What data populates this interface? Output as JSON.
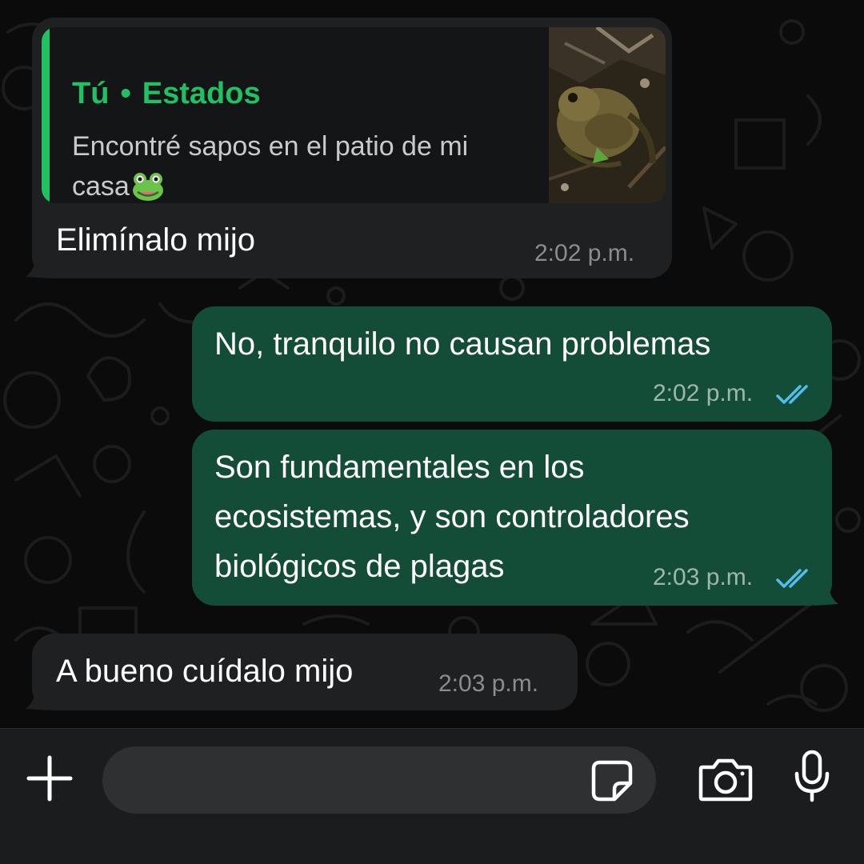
{
  "chat": {
    "messages": [
      {
        "direction": "incoming",
        "quoted_status": {
          "author": "Tú",
          "source": "Estados",
          "text": "Encontré sapos en el patio de mi casa",
          "emoji_icon": "frog-emoji-icon",
          "thumbnail": "toad-photo-thumbnail"
        },
        "text": "Elimínalo mijo",
        "time": "2:02 p.m."
      },
      {
        "direction": "outgoing",
        "text": "No, tranquilo no causan problemas",
        "time": "2:02 p.m.",
        "status_icon": "double-check-read-icon"
      },
      {
        "direction": "outgoing",
        "text": "Son fundamentales en los\necosistemas, y son controladores\nbiológicos de plagas",
        "time": "2:03 p.m.",
        "status_icon": "double-check-read-icon"
      },
      {
        "direction": "incoming",
        "text": "A bueno cuídalo mijo",
        "time": "2:03 p.m."
      }
    ]
  },
  "input_bar": {
    "placeholder": "",
    "icons": [
      "plus-icon",
      "sticker-icon",
      "camera-icon",
      "microphone-icon"
    ]
  },
  "colors": {
    "background": "#0b0b0b",
    "incoming_bubble": "#1f2021",
    "outgoing_bubble": "#144d37",
    "accent": "#21c063",
    "read_ticks": "#53bdeb",
    "timestamp": "#8a8d90"
  }
}
